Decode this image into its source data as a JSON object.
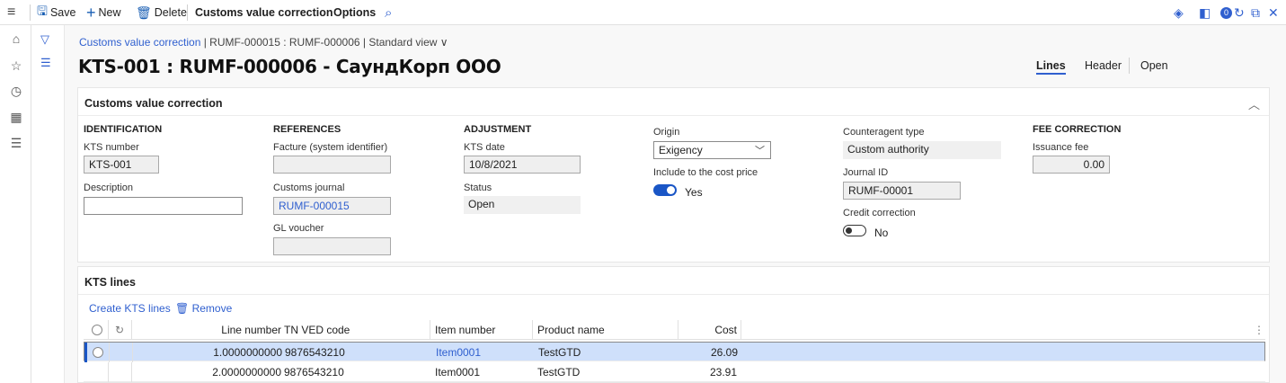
{
  "toolbar": {
    "save": "Save",
    "new": "New",
    "delete": "Delete",
    "customs_value_correction": "Customs value correction",
    "options": "Options"
  },
  "breadcrumb": {
    "link": "Customs value correction",
    "path": "| RUMF-000015 : RUMF-000006 | Standard view",
    "chevron": "∨"
  },
  "page": {
    "title": "KTS-001 : RUMF-000006 - СаундКорп ООО",
    "tabs": [
      "Lines",
      "Header",
      "Open"
    ]
  },
  "header_section": {
    "title": "Customs value correction",
    "identification": {
      "heading": "IDENTIFICATION",
      "kts_number_label": "KTS number",
      "kts_number": "KTS-001",
      "description_label": "Description",
      "description": ""
    },
    "references": {
      "heading": "REFERENCES",
      "facture_label": "Facture (system identifier)",
      "facture": "",
      "customs_journal_label": "Customs journal",
      "customs_journal": "RUMF-000015",
      "gl_voucher_label": "GL voucher",
      "gl_voucher": ""
    },
    "adjustment": {
      "heading": "ADJUSTMENT",
      "kts_date_label": "KTS date",
      "kts_date": "10/8/2021",
      "status_label": "Status",
      "status": "Open"
    },
    "origin": {
      "origin_label": "Origin",
      "origin": "Exigency",
      "include_label": "Include to the cost price",
      "include_value": "Yes"
    },
    "counteragent": {
      "type_label": "Counteragent type",
      "type": "Custom authority",
      "journal_id_label": "Journal ID",
      "journal_id": "RUMF-00001",
      "credit_label": "Credit correction",
      "credit_value": "No"
    },
    "fee": {
      "heading": "FEE CORRECTION",
      "issuance_label": "Issuance fee",
      "issuance": "0.00"
    }
  },
  "lines_section": {
    "title": "KTS lines",
    "create": "Create KTS lines",
    "remove": "Remove",
    "columns": [
      "Line number",
      "TN VED code",
      "Item number",
      "Product name",
      "Cost"
    ],
    "rows": [
      {
        "line": "1.0000000000",
        "tnved": "9876543210",
        "item": "Item0001",
        "product": "TestGTD",
        "cost": "26.09"
      },
      {
        "line": "2.0000000000",
        "tnved": "9876543210",
        "item": "Item0001",
        "product": "TestGTD",
        "cost": "23.91"
      }
    ]
  },
  "icons": {
    "hamburger": "≡",
    "save": "🖫",
    "new": "+",
    "delete": "🗑",
    "search": "⌕",
    "home": "⌂",
    "star": "☆",
    "clock": "◷",
    "workspace": "▦",
    "list": "☰",
    "filter": "▽",
    "collapse": "︿",
    "refresh": "↻",
    "more": "⋮",
    "close": "✕"
  },
  "colors": {
    "accent": "#2f5fcf",
    "selected_row": "#cfe0fb",
    "toggle_on": "#1a56c6"
  }
}
